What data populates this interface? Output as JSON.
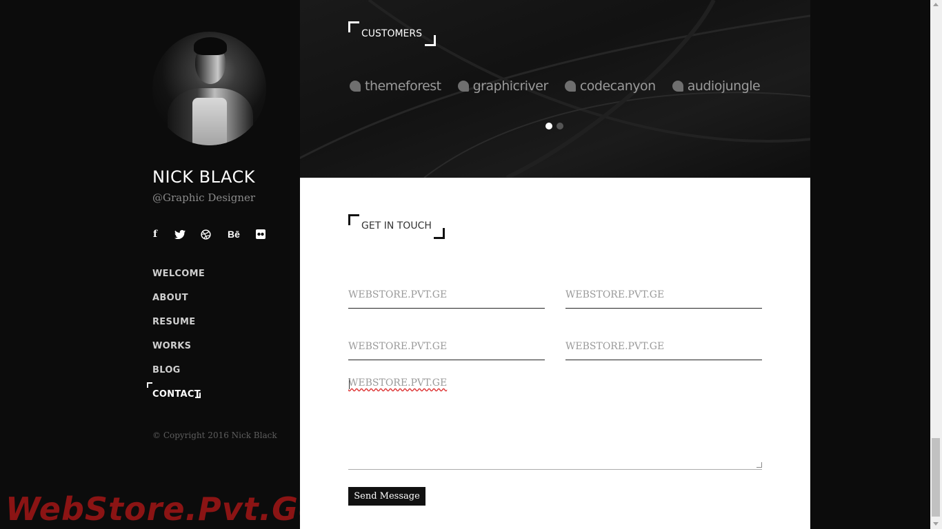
{
  "profile": {
    "name": "NICK BLACK",
    "subtitle": "@Graphic Designer"
  },
  "socials": [
    {
      "icon": "facebook-icon",
      "glyph": "f"
    },
    {
      "icon": "twitter-icon",
      "glyph": "❦"
    },
    {
      "icon": "dribbble-icon",
      "glyph": "◎"
    },
    {
      "icon": "behance-icon",
      "glyph": "Bē"
    },
    {
      "icon": "flickr-icon",
      "glyph": "●●"
    }
  ],
  "nav": {
    "items": [
      "WELCOME",
      "ABOUT",
      "RESUME",
      "WORKS",
      "BLOG",
      "CONTACT"
    ],
    "active": "CONTACT"
  },
  "copyright": "© Copyright 2016 Nick Black",
  "watermark": "WebStore.Pvt.Ge",
  "customers": {
    "title": "CUSTOMERS",
    "logos": [
      "themeforest",
      "graphicriver",
      "codecanyon",
      "audiojungle"
    ],
    "carousel_pages": 2,
    "carousel_active": 1
  },
  "contact": {
    "title": "GET IN TOUCH",
    "fields": [
      "WEBSTORE.PVT.GE",
      "WEBSTORE.PVT.GE",
      "WEBSTORE.PVT.GE",
      "WEBSTORE.PVT.GE"
    ],
    "message": "WEBSTORE.PVT.GE",
    "send_label": "Send Message"
  },
  "colors": {
    "sidebar_bg": "#0c0c0c",
    "watermark": "#8b1414",
    "button_bg": "#111111"
  }
}
